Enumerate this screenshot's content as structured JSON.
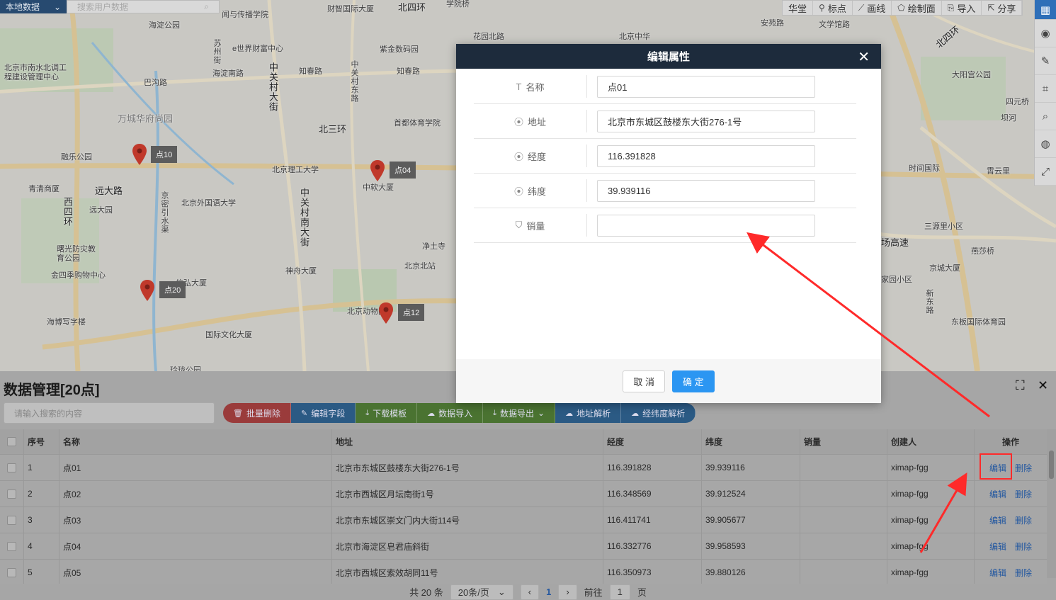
{
  "map": {
    "layer_select": "本地数据",
    "user_search_placeholder": "搜索用户数据",
    "toolbar": [
      {
        "label": "华堂",
        "icon": ""
      },
      {
        "label": "标点",
        "icon": "pin-icon"
      },
      {
        "label": "画线",
        "icon": "polyline-icon"
      },
      {
        "label": "绘制面",
        "icon": "polygon-icon"
      },
      {
        "label": "导入",
        "icon": "import-icon"
      },
      {
        "label": "分享",
        "icon": "share-icon"
      }
    ],
    "markers": [
      {
        "label": "点10"
      },
      {
        "label": "点04"
      },
      {
        "label": "点20"
      },
      {
        "label": "点12"
      }
    ],
    "labels": [
      "海淀公园",
      "财智国际大厦",
      "北四环",
      "学院桥",
      "闻与传播学院",
      "北京市南水北调工程建设管理中心",
      "苏州街",
      "e世界财富中心",
      "紫金数码园",
      "花园北路",
      "北京中华",
      "安苑路",
      "文学馆路",
      "巴沟路",
      "海淀南路",
      "知春路",
      "知春路",
      "中关村大街",
      "中关村东路",
      "北四环",
      "万城华府尚园",
      "北三环",
      "首都体育学院",
      "大阳宫公园",
      "融乐公园",
      "北京理工大学",
      "中软大厦",
      "青清商厦",
      "远大路",
      "远大园",
      "西四环",
      "北京外国语大学",
      "中关村南大街",
      "曙光防灾教育公园",
      "金四季购物中心",
      "净土寺",
      "北京北站",
      "神舟大厦",
      "信弘大厦",
      "海博写字楼",
      "北京动物园",
      "国际文化大厦",
      "玲珑公园",
      "时间国际",
      "霄云里",
      "三源里小区",
      "燕莎桥",
      "京城大厦",
      "家园小区",
      "新东路",
      "东板国际体育园",
      "四元桥",
      "坝河",
      "京密引水渠",
      "场高速"
    ]
  },
  "panel": {
    "title": "数据管理[20点]",
    "search_placeholder": "请输入搜索的内容",
    "actions": [
      {
        "label": "批量删除",
        "icon": "trash-icon",
        "color": "#d9534f"
      },
      {
        "label": "编辑字段",
        "icon": "edit-icon",
        "color": "#337ab7"
      },
      {
        "label": "下载模板",
        "icon": "download-icon",
        "color": "#5cb85c"
      },
      {
        "label": "数据导入",
        "icon": "cloud-upload-icon",
        "color": "#5cb85c"
      },
      {
        "label": "数据导出",
        "icon": "download-icon",
        "color": "#5cb85c"
      },
      {
        "label": "地址解析",
        "icon": "cloud-icon",
        "color": "#337ab7"
      },
      {
        "label": "经纬度解析",
        "icon": "cloud-icon",
        "color": "#337ab7"
      }
    ],
    "columns": {
      "no": "序号",
      "name": "名称",
      "address": "地址",
      "lng": "经度",
      "lat": "纬度",
      "sales": "销量",
      "creator": "创建人",
      "ops": "操作"
    },
    "rows": [
      {
        "no": "1",
        "name": "点01",
        "address": "北京市东城区鼓楼东大街276-1号",
        "lng": "116.391828",
        "lat": "39.939116",
        "sales": "",
        "creator": "ximap-fgg"
      },
      {
        "no": "2",
        "name": "点02",
        "address": "北京市西城区月坛南街1号",
        "lng": "116.348569",
        "lat": "39.912524",
        "sales": "",
        "creator": "ximap-fgg"
      },
      {
        "no": "3",
        "name": "点03",
        "address": "北京市东城区崇文门内大街114号",
        "lng": "116.411741",
        "lat": "39.905677",
        "sales": "",
        "creator": "ximap-fgg"
      },
      {
        "no": "4",
        "name": "点04",
        "address": "北京市海淀区皂君庙斜街",
        "lng": "116.332776",
        "lat": "39.958593",
        "sales": "",
        "creator": "ximap-fgg"
      },
      {
        "no": "5",
        "name": "点05",
        "address": "北京市西城区索效胡同11号",
        "lng": "116.350973",
        "lat": "39.880126",
        "sales": "",
        "creator": "ximap-fgg"
      }
    ],
    "op_edit": "编辑",
    "op_delete": "删除",
    "pager": {
      "total": "共 20 条",
      "page_size": "20条/页",
      "current": "1",
      "goto_label": "前往",
      "goto_value": "1",
      "goto_suffix": "页"
    }
  },
  "modal": {
    "title": "编辑属性",
    "fields": [
      {
        "label": "名称",
        "icon": "text-icon",
        "value": "点01"
      },
      {
        "label": "地址",
        "icon": "location-icon",
        "value": "北京市东城区鼓楼东大街276-1号"
      },
      {
        "label": "经度",
        "icon": "location-icon",
        "value": "116.391828"
      },
      {
        "label": "纬度",
        "icon": "location-icon",
        "value": "39.939116"
      },
      {
        "label": "销量",
        "icon": "tag-icon",
        "value": ""
      }
    ],
    "cancel": "取 消",
    "ok": "确 定"
  },
  "colors": {
    "modal_header": "#1d2b3c",
    "primary": "#2b96f2",
    "annotation": "#ff2a2a"
  }
}
